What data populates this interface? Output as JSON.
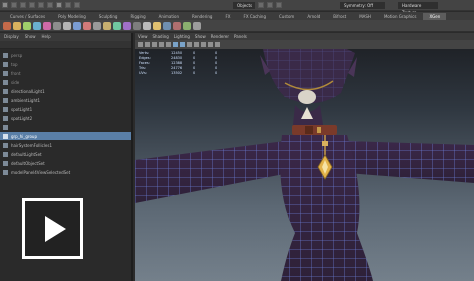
{
  "status_bar": {
    "field_a": "Objects",
    "field_b": "Symmetry: Off",
    "field_c": "Hardware Texture"
  },
  "shelf_tabs": [
    {
      "label": "Curves / Surfaces",
      "active": false
    },
    {
      "label": "Poly Modeling",
      "active": false
    },
    {
      "label": "Sculpting",
      "active": false
    },
    {
      "label": "Rigging",
      "active": false
    },
    {
      "label": "Animation",
      "active": false
    },
    {
      "label": "Rendering",
      "active": false
    },
    {
      "label": "FX",
      "active": false
    },
    {
      "label": "FX Caching",
      "active": false
    },
    {
      "label": "Custom",
      "active": false
    },
    {
      "label": "Arnold",
      "active": false
    },
    {
      "label": "Bifrost",
      "active": false
    },
    {
      "label": "MASH",
      "active": false
    },
    {
      "label": "Motion Graphics",
      "active": false
    },
    {
      "label": "XGen",
      "active": true
    }
  ],
  "shelf_icon_colors": [
    "#c46a4a",
    "#d9b25e",
    "#9fcf6a",
    "#6ab0cf",
    "#cf6aa8",
    "#8d8d8d",
    "#b4b4b4",
    "#7a9cd2",
    "#d27a7a",
    "#9a9a9a",
    "#c8b070",
    "#70c8a0",
    "#a070c8",
    "#7d7d7d",
    "#bbbbbb",
    "#e0c070",
    "#6f8fb0",
    "#b06f6f",
    "#8bb06f",
    "#9d9d9d"
  ],
  "outliner": {
    "menu": [
      "Display",
      "Show",
      "Help"
    ],
    "items": [
      {
        "label": "persp",
        "selected": false,
        "dim": true
      },
      {
        "label": "top",
        "selected": false,
        "dim": true
      },
      {
        "label": "front",
        "selected": false,
        "dim": true
      },
      {
        "label": "side",
        "selected": false,
        "dim": true
      },
      {
        "label": "directionalLight1",
        "selected": false,
        "dim": false
      },
      {
        "label": "ambientLight1",
        "selected": false,
        "dim": false
      },
      {
        "label": "spotLight1",
        "selected": false,
        "dim": false
      },
      {
        "label": "spotLight2",
        "selected": false,
        "dim": false
      },
      {
        "label": "",
        "selected": false,
        "dim": false
      },
      {
        "label": "grp_hi_group",
        "selected": true,
        "dim": false
      },
      {
        "label": "hairSystemFollicles1",
        "selected": false,
        "dim": false
      },
      {
        "label": "defaultLightSet",
        "selected": false,
        "dim": false
      },
      {
        "label": "defaultObjectSet",
        "selected": false,
        "dim": false
      },
      {
        "label": "modelPanel4ViewSelectedSet",
        "selected": false,
        "dim": false
      }
    ]
  },
  "play_button": {
    "icon": "play-icon"
  },
  "viewport": {
    "menu": [
      "View",
      "Shading",
      "Lighting",
      "Show",
      "Renderer",
      "Panels"
    ],
    "hud": [
      [
        "Verts:",
        "12450",
        "0",
        "0"
      ],
      [
        "Edges:",
        "24830",
        "0",
        "0"
      ],
      [
        "Faces:",
        "12388",
        "0",
        "0"
      ],
      [
        "Tris:",
        "24776",
        "0",
        "0"
      ],
      [
        "UVs:",
        "13502",
        "0",
        "0"
      ]
    ]
  },
  "colors": {
    "selection": "#5a7fa7",
    "wireframe": "#6f86e8",
    "dress": "#3e2a4c",
    "belt": "#7a3a2a",
    "gem": "#e2b24a"
  }
}
